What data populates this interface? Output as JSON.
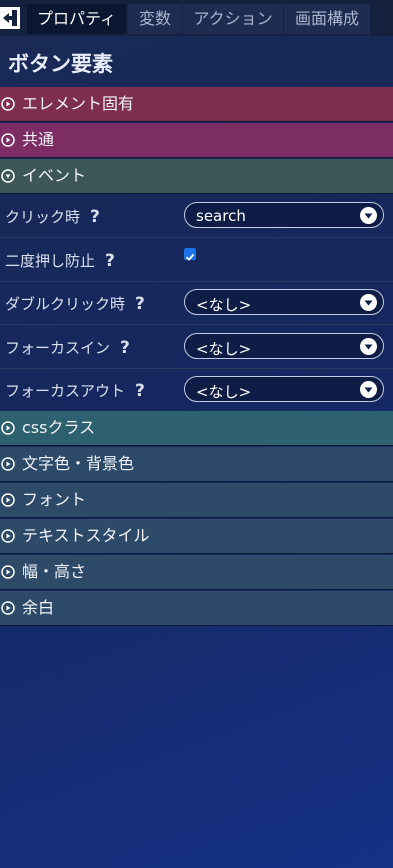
{
  "tabs": [
    {
      "label": "プロパティ"
    },
    {
      "label": "変数"
    },
    {
      "label": "アクション"
    },
    {
      "label": "画面構成"
    }
  ],
  "title": "ボタン要素",
  "sections": {
    "element_specific": "エレメント固有",
    "common": "共通",
    "event": "イベント",
    "css_class": "cssクラス",
    "color": "文字色・背景色",
    "font": "フォント",
    "text_style": "テキストスタイル",
    "size": "幅・高さ",
    "margin": "余白"
  },
  "event_props": {
    "click": {
      "label": "クリック時",
      "value": "search"
    },
    "double_prevent": {
      "label": "二度押し防止",
      "checked": true
    },
    "double_click": {
      "label": "ダブルクリック時",
      "value": "<なし>"
    },
    "focus_in": {
      "label": "フォーカスイン",
      "value": "<なし>"
    },
    "focus_out": {
      "label": "フォーカスアウト",
      "value": "<なし>"
    }
  },
  "help_mark": "?",
  "colors": {
    "accent_blue": "#1a73e8",
    "section_pink": "#7e2f4f",
    "section_green": "#3d5757",
    "section_teal": "#2e6170"
  }
}
